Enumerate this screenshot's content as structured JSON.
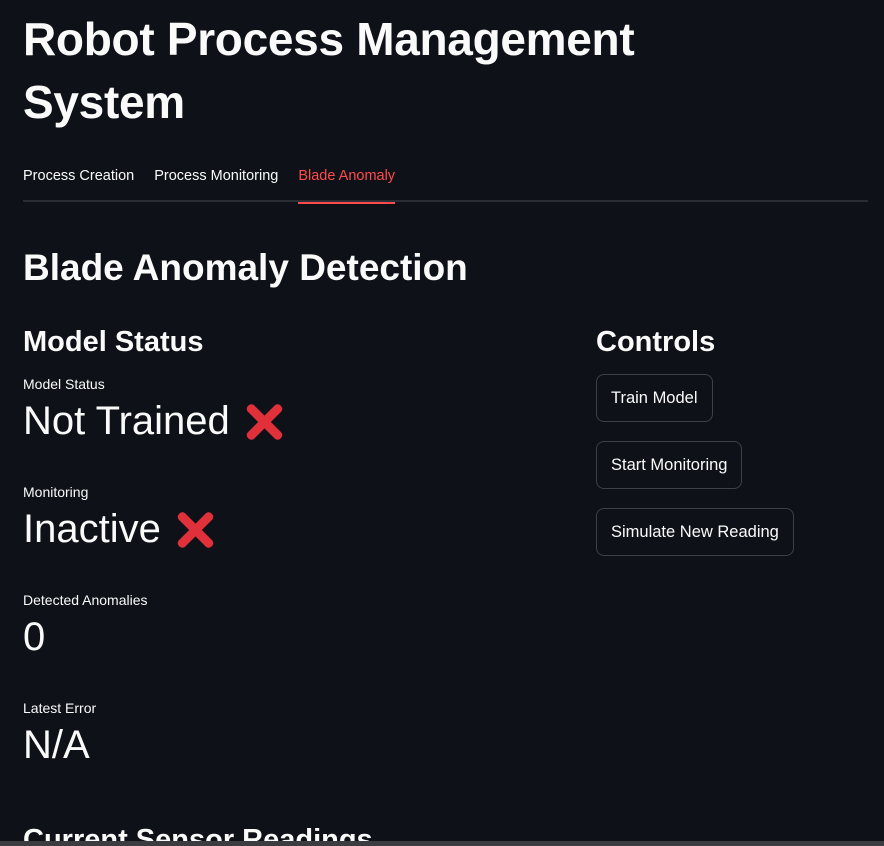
{
  "app": {
    "title": "Robot Process Management System"
  },
  "tabs": [
    {
      "label": "Process Creation",
      "active": false
    },
    {
      "label": "Process Monitoring",
      "active": false
    },
    {
      "label": "Blade Anomaly",
      "active": true
    }
  ],
  "main": {
    "title": "Blade Anomaly Detection",
    "model_status_section": {
      "title": "Model Status",
      "metrics": [
        {
          "label": "Model Status",
          "value": "Not Trained",
          "icon": "cross-mark-icon"
        },
        {
          "label": "Monitoring",
          "value": "Inactive",
          "icon": "cross-mark-icon"
        },
        {
          "label": "Detected Anomalies",
          "value": "0"
        },
        {
          "label": "Latest Error",
          "value": "N/A"
        }
      ]
    },
    "controls_section": {
      "title": "Controls",
      "buttons": [
        {
          "label": "Train Model"
        },
        {
          "label": "Start Monitoring"
        },
        {
          "label": "Simulate New Reading"
        }
      ]
    },
    "next_section_title": "Current Sensor Readings"
  },
  "colors": {
    "background": "#0e1117",
    "text": "#fafafa",
    "accent": "#ff4b4b",
    "cross": "#e0303a"
  }
}
